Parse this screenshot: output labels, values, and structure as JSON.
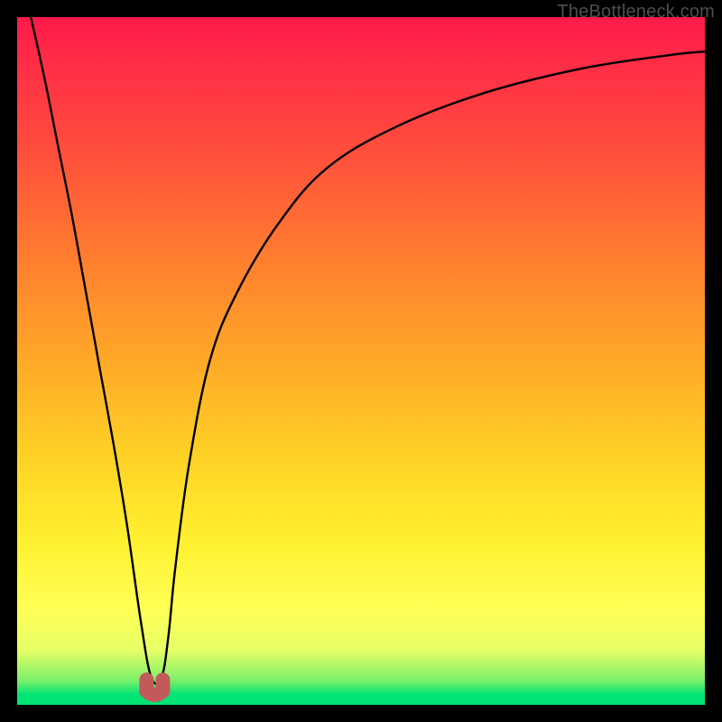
{
  "watermark": "TheBottleneck.com",
  "colors": {
    "background": "#000000",
    "gradient_top": "#ff1a4b",
    "gradient_mid": "#ffd226",
    "gradient_bottom": "#00e474",
    "curve": "#000000",
    "notch": "#c35a5a"
  },
  "chart_data": {
    "type": "line",
    "title": "",
    "xlabel": "",
    "ylabel": "",
    "xlim": [
      0,
      100
    ],
    "ylim": [
      0,
      100
    ],
    "grid": false,
    "series": [
      {
        "name": "bottleneck-curve",
        "x": [
          2,
          4,
          6,
          8,
          10,
          12,
          14,
          16,
          18,
          19.5,
          21,
          22,
          23,
          25,
          28,
          32,
          38,
          45,
          55,
          68,
          82,
          95,
          100
        ],
        "y": [
          100,
          91,
          81,
          71,
          60,
          49,
          38,
          26,
          12,
          4,
          4,
          10,
          20,
          35,
          50,
          60,
          70,
          78,
          84,
          89,
          92.5,
          94.5,
          95
        ]
      }
    ],
    "annotations": [
      {
        "name": "optimal-notch",
        "x": 20,
        "y": 2
      }
    ]
  }
}
